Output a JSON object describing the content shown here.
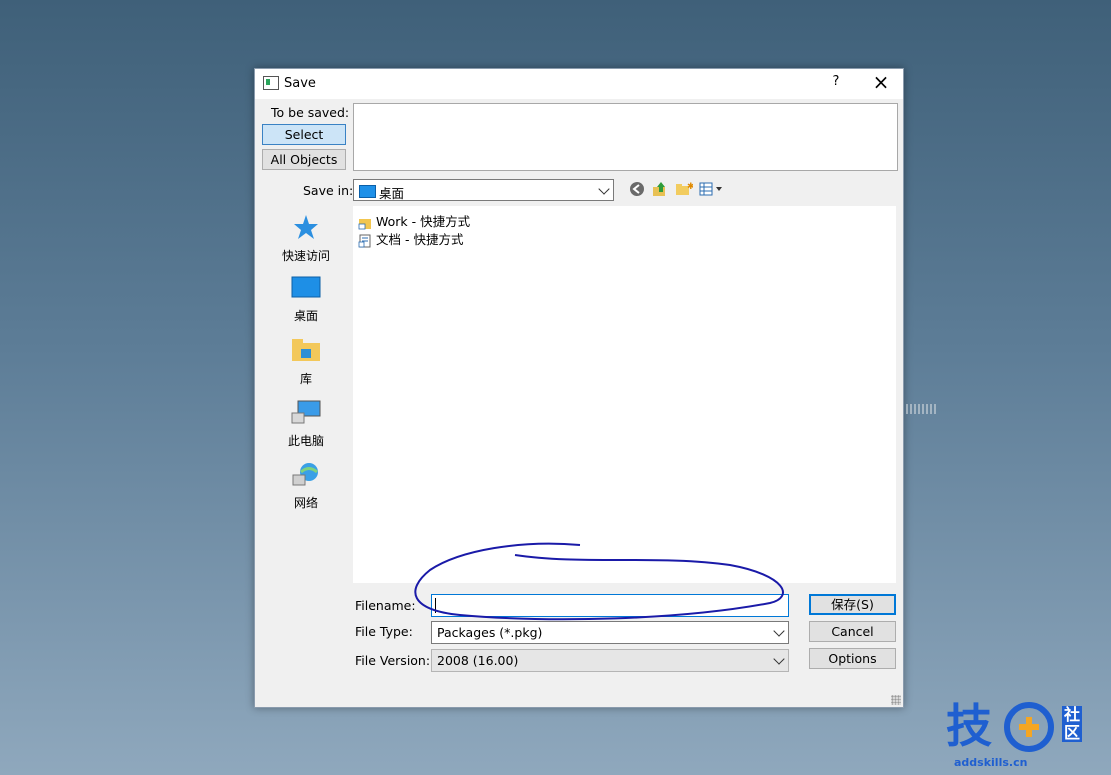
{
  "window": {
    "title": "Save",
    "help": "?",
    "close": "×"
  },
  "selection": {
    "label": "To be saved:",
    "select_btn": "Select",
    "all_objects_btn": "All Objects"
  },
  "save_in": {
    "label": "Save in:",
    "value": "桌面"
  },
  "places": [
    {
      "label": "快速访问",
      "icon": "star-icon"
    },
    {
      "label": "桌面",
      "icon": "desktop-icon"
    },
    {
      "label": "库",
      "icon": "library-icon"
    },
    {
      "label": "此电脑",
      "icon": "computer-icon"
    },
    {
      "label": "网络",
      "icon": "network-icon"
    }
  ],
  "files": [
    {
      "name": "Work - 快捷方式",
      "icon": "folder-shortcut-icon"
    },
    {
      "name": "文档 - 快捷方式",
      "icon": "document-shortcut-icon"
    }
  ],
  "form": {
    "filename_label": "Filename:",
    "filename_value": "",
    "filetype_label": "File Type:",
    "filetype_value": "Packages (*.pkg)",
    "fileversion_label": "File Version:",
    "fileversion_value": "2008 (16.00)"
  },
  "buttons": {
    "save": "保存(S)",
    "cancel": "Cancel",
    "options": "Options"
  },
  "watermark": {
    "brand": "技",
    "side": "社区",
    "url": "addskills.cn"
  },
  "colors": {
    "accent": "#0078d7",
    "annotation": "#1a1aa8"
  }
}
